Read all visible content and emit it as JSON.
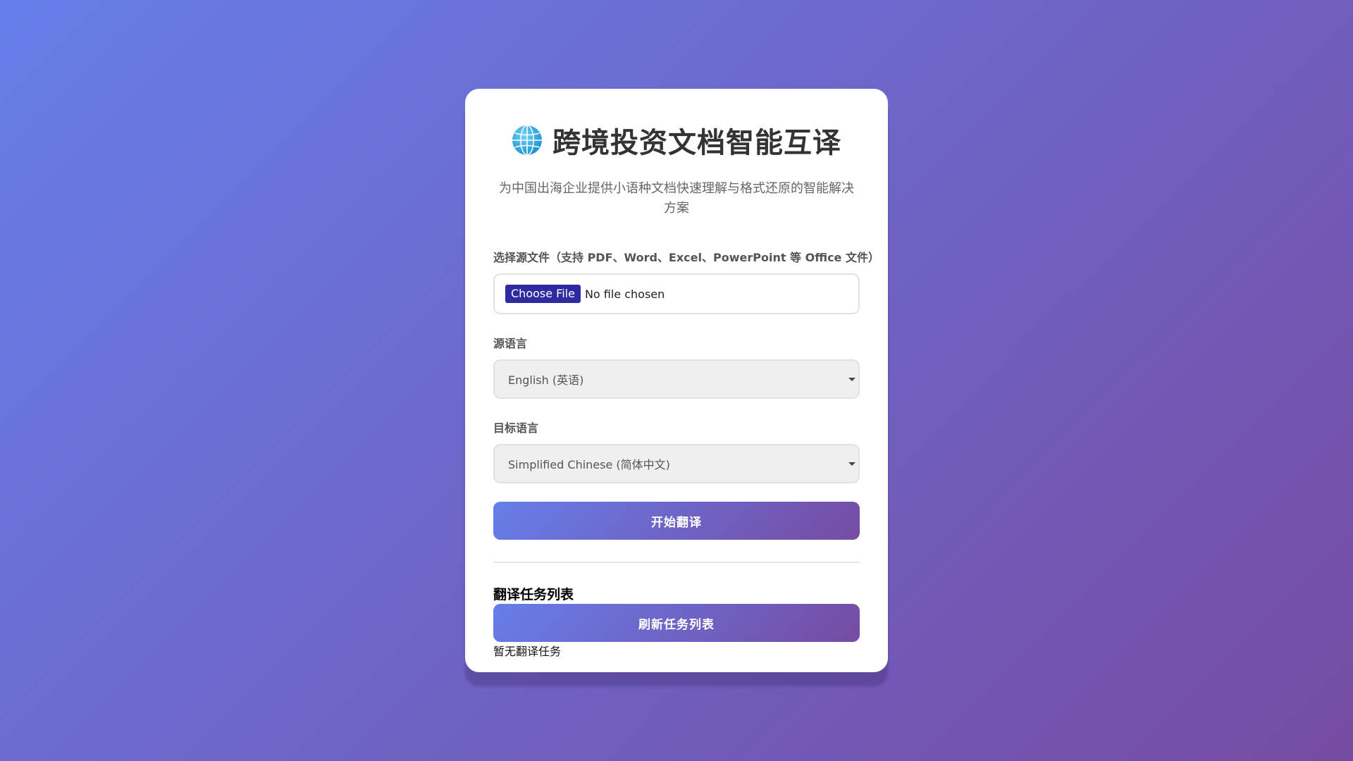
{
  "header": {
    "title": "跨境投资文档智能互译",
    "subtitle": "为中国出海企业提供小语种文档快速理解与格式还原的智能解决方案",
    "icon": "globe-icon"
  },
  "form": {
    "file_label": "选择源文件（支持 PDF、Word、Excel、PowerPoint 等 Office 文件）",
    "file_button": "Choose File",
    "file_status": "No file chosen",
    "source_label": "源语言",
    "source_value": "English (英语)",
    "target_label": "目标语言",
    "target_value": "Simplified Chinese (简体中文)",
    "submit_label": "开始翻译"
  },
  "tasks": {
    "title": "翻译任务列表",
    "refresh_label": "刷新任务列表",
    "empty_text": "暂无翻译任务"
  },
  "colors": {
    "gradient_start": "#667eea",
    "gradient_end": "#764ba2",
    "file_button_bg": "#2e2ba1"
  }
}
